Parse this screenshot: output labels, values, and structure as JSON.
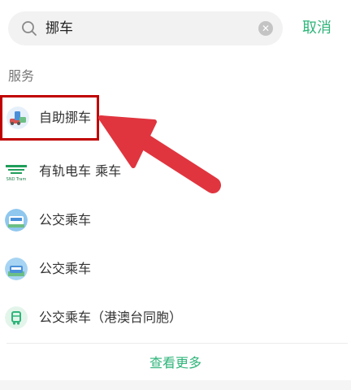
{
  "search": {
    "query": "挪车",
    "cancel_label": "取消"
  },
  "section": {
    "title": "服务"
  },
  "services": [
    {
      "label": "自助挪车",
      "icon": "car-move-icon"
    },
    {
      "label": "有轨电车 乘车",
      "icon": "tram-logo-icon"
    },
    {
      "label": "公交乘车",
      "icon": "bus-icon"
    },
    {
      "label": "公交乘车",
      "icon": "bus-icon"
    },
    {
      "label": "公交乘车（港澳台同胞）",
      "icon": "bus-green-icon"
    }
  ],
  "footer": {
    "more_label": "查看更多"
  },
  "colors": {
    "accent": "#2fb47a",
    "highlight": "#c00000",
    "arrow": "#e0353f"
  }
}
